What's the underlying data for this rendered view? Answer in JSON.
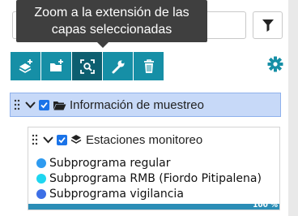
{
  "filter": {
    "placeholder": "Filtrar"
  },
  "tooltip": {
    "line1": "Zoom a la extensión de las",
    "line2": "capas seleccionadas"
  },
  "toolbar": {
    "buttons": [
      {
        "icon": "add-layer-icon"
      },
      {
        "icon": "add-folder-icon"
      },
      {
        "icon": "zoom-to-extent-icon",
        "active": true
      },
      {
        "icon": "wrench-icon"
      },
      {
        "icon": "trash-icon"
      }
    ]
  },
  "group": {
    "label": "Información de muestreo",
    "checked": true,
    "expanded": true
  },
  "layer": {
    "label": "Estaciones monitoreo",
    "checked": true,
    "expanded": true,
    "legend": [
      {
        "label": "Subprograma regular",
        "color": "#2e9bf0"
      },
      {
        "label": "Subprograma RMB (Fiordo Pitipalena)",
        "color": "#1ed6f0"
      },
      {
        "label": "Subprograma vigilancia",
        "color": "#3d6fe6"
      }
    ],
    "progress": {
      "label": "100 %",
      "value": 1.0
    }
  },
  "colors": {
    "accent": "#168fa6",
    "active": "#0d5f70",
    "selection": "#c7d9f8",
    "checkbox": "#1a73e8"
  }
}
